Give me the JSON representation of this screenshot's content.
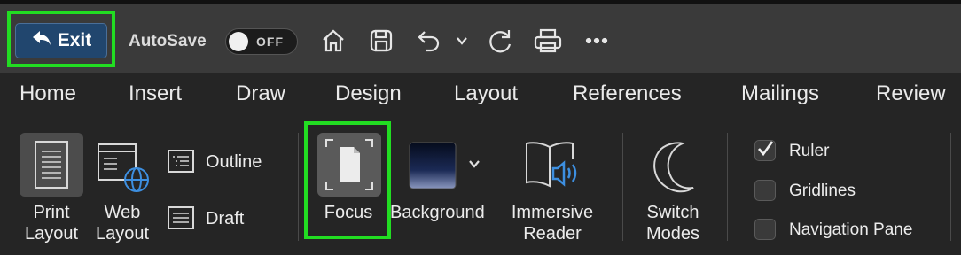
{
  "quick_access": {
    "exit_label": "Exit",
    "autosave_label": "AutoSave",
    "autosave_state": "OFF",
    "icons": [
      "home-icon",
      "save-icon",
      "undo-icon",
      "chevron-down-icon",
      "redo-icon",
      "print-icon",
      "more-icon"
    ]
  },
  "tabs": [
    "Home",
    "Insert",
    "Draw",
    "Design",
    "Layout",
    "References",
    "Mailings",
    "Review"
  ],
  "ribbon": {
    "print_layout": [
      "Print",
      "Layout"
    ],
    "web_layout": [
      "Web",
      "Layout"
    ],
    "outline": "Outline",
    "draft": "Draft",
    "focus": "Focus",
    "background": "Background",
    "immersive_reader": [
      "Immersive",
      "Reader"
    ],
    "switch_modes": [
      "Switch",
      "Modes"
    ],
    "ruler": "Ruler",
    "ruler_checked": true,
    "gridlines": "Gridlines",
    "gridlines_checked": false,
    "navigation_pane": "Navigation Pane",
    "navigation_pane_checked": false
  },
  "colors": {
    "highlight": "#22dd22",
    "exit_button": "#21466e",
    "toolbar_bg": "#3a3a3a",
    "ribbon_bg": "#252525"
  }
}
